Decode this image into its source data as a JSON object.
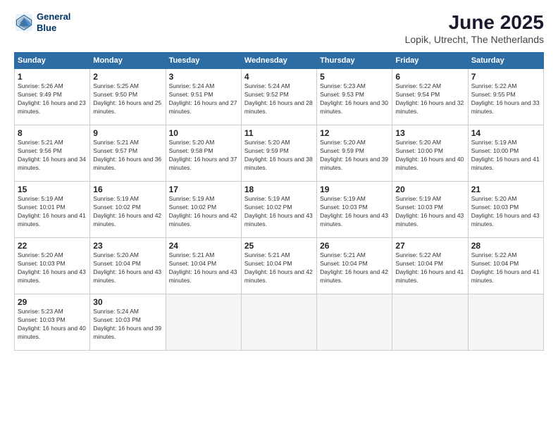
{
  "header": {
    "logo_line1": "General",
    "logo_line2": "Blue",
    "title": "June 2025",
    "subtitle": "Lopik, Utrecht, The Netherlands"
  },
  "weekdays": [
    "Sunday",
    "Monday",
    "Tuesday",
    "Wednesday",
    "Thursday",
    "Friday",
    "Saturday"
  ],
  "weeks": [
    [
      {
        "day": "1",
        "sunrise": "5:26 AM",
        "sunset": "9:49 PM",
        "daylight": "16 hours and 23 minutes."
      },
      {
        "day": "2",
        "sunrise": "5:25 AM",
        "sunset": "9:50 PM",
        "daylight": "16 hours and 25 minutes."
      },
      {
        "day": "3",
        "sunrise": "5:24 AM",
        "sunset": "9:51 PM",
        "daylight": "16 hours and 27 minutes."
      },
      {
        "day": "4",
        "sunrise": "5:24 AM",
        "sunset": "9:52 PM",
        "daylight": "16 hours and 28 minutes."
      },
      {
        "day": "5",
        "sunrise": "5:23 AM",
        "sunset": "9:53 PM",
        "daylight": "16 hours and 30 minutes."
      },
      {
        "day": "6",
        "sunrise": "5:22 AM",
        "sunset": "9:54 PM",
        "daylight": "16 hours and 32 minutes."
      },
      {
        "day": "7",
        "sunrise": "5:22 AM",
        "sunset": "9:55 PM",
        "daylight": "16 hours and 33 minutes."
      }
    ],
    [
      {
        "day": "8",
        "sunrise": "5:21 AM",
        "sunset": "9:56 PM",
        "daylight": "16 hours and 34 minutes."
      },
      {
        "day": "9",
        "sunrise": "5:21 AM",
        "sunset": "9:57 PM",
        "daylight": "16 hours and 36 minutes."
      },
      {
        "day": "10",
        "sunrise": "5:20 AM",
        "sunset": "9:58 PM",
        "daylight": "16 hours and 37 minutes."
      },
      {
        "day": "11",
        "sunrise": "5:20 AM",
        "sunset": "9:59 PM",
        "daylight": "16 hours and 38 minutes."
      },
      {
        "day": "12",
        "sunrise": "5:20 AM",
        "sunset": "9:59 PM",
        "daylight": "16 hours and 39 minutes."
      },
      {
        "day": "13",
        "sunrise": "5:20 AM",
        "sunset": "10:00 PM",
        "daylight": "16 hours and 40 minutes."
      },
      {
        "day": "14",
        "sunrise": "5:19 AM",
        "sunset": "10:00 PM",
        "daylight": "16 hours and 41 minutes."
      }
    ],
    [
      {
        "day": "15",
        "sunrise": "5:19 AM",
        "sunset": "10:01 PM",
        "daylight": "16 hours and 41 minutes."
      },
      {
        "day": "16",
        "sunrise": "5:19 AM",
        "sunset": "10:02 PM",
        "daylight": "16 hours and 42 minutes."
      },
      {
        "day": "17",
        "sunrise": "5:19 AM",
        "sunset": "10:02 PM",
        "daylight": "16 hours and 42 minutes."
      },
      {
        "day": "18",
        "sunrise": "5:19 AM",
        "sunset": "10:02 PM",
        "daylight": "16 hours and 43 minutes."
      },
      {
        "day": "19",
        "sunrise": "5:19 AM",
        "sunset": "10:03 PM",
        "daylight": "16 hours and 43 minutes."
      },
      {
        "day": "20",
        "sunrise": "5:19 AM",
        "sunset": "10:03 PM",
        "daylight": "16 hours and 43 minutes."
      },
      {
        "day": "21",
        "sunrise": "5:20 AM",
        "sunset": "10:03 PM",
        "daylight": "16 hours and 43 minutes."
      }
    ],
    [
      {
        "day": "22",
        "sunrise": "5:20 AM",
        "sunset": "10:03 PM",
        "daylight": "16 hours and 43 minutes."
      },
      {
        "day": "23",
        "sunrise": "5:20 AM",
        "sunset": "10:04 PM",
        "daylight": "16 hours and 43 minutes."
      },
      {
        "day": "24",
        "sunrise": "5:21 AM",
        "sunset": "10:04 PM",
        "daylight": "16 hours and 43 minutes."
      },
      {
        "day": "25",
        "sunrise": "5:21 AM",
        "sunset": "10:04 PM",
        "daylight": "16 hours and 42 minutes."
      },
      {
        "day": "26",
        "sunrise": "5:21 AM",
        "sunset": "10:04 PM",
        "daylight": "16 hours and 42 minutes."
      },
      {
        "day": "27",
        "sunrise": "5:22 AM",
        "sunset": "10:04 PM",
        "daylight": "16 hours and 41 minutes."
      },
      {
        "day": "28",
        "sunrise": "5:22 AM",
        "sunset": "10:04 PM",
        "daylight": "16 hours and 41 minutes."
      }
    ],
    [
      {
        "day": "29",
        "sunrise": "5:23 AM",
        "sunset": "10:03 PM",
        "daylight": "16 hours and 40 minutes."
      },
      {
        "day": "30",
        "sunrise": "5:24 AM",
        "sunset": "10:03 PM",
        "daylight": "16 hours and 39 minutes."
      },
      null,
      null,
      null,
      null,
      null
    ]
  ]
}
